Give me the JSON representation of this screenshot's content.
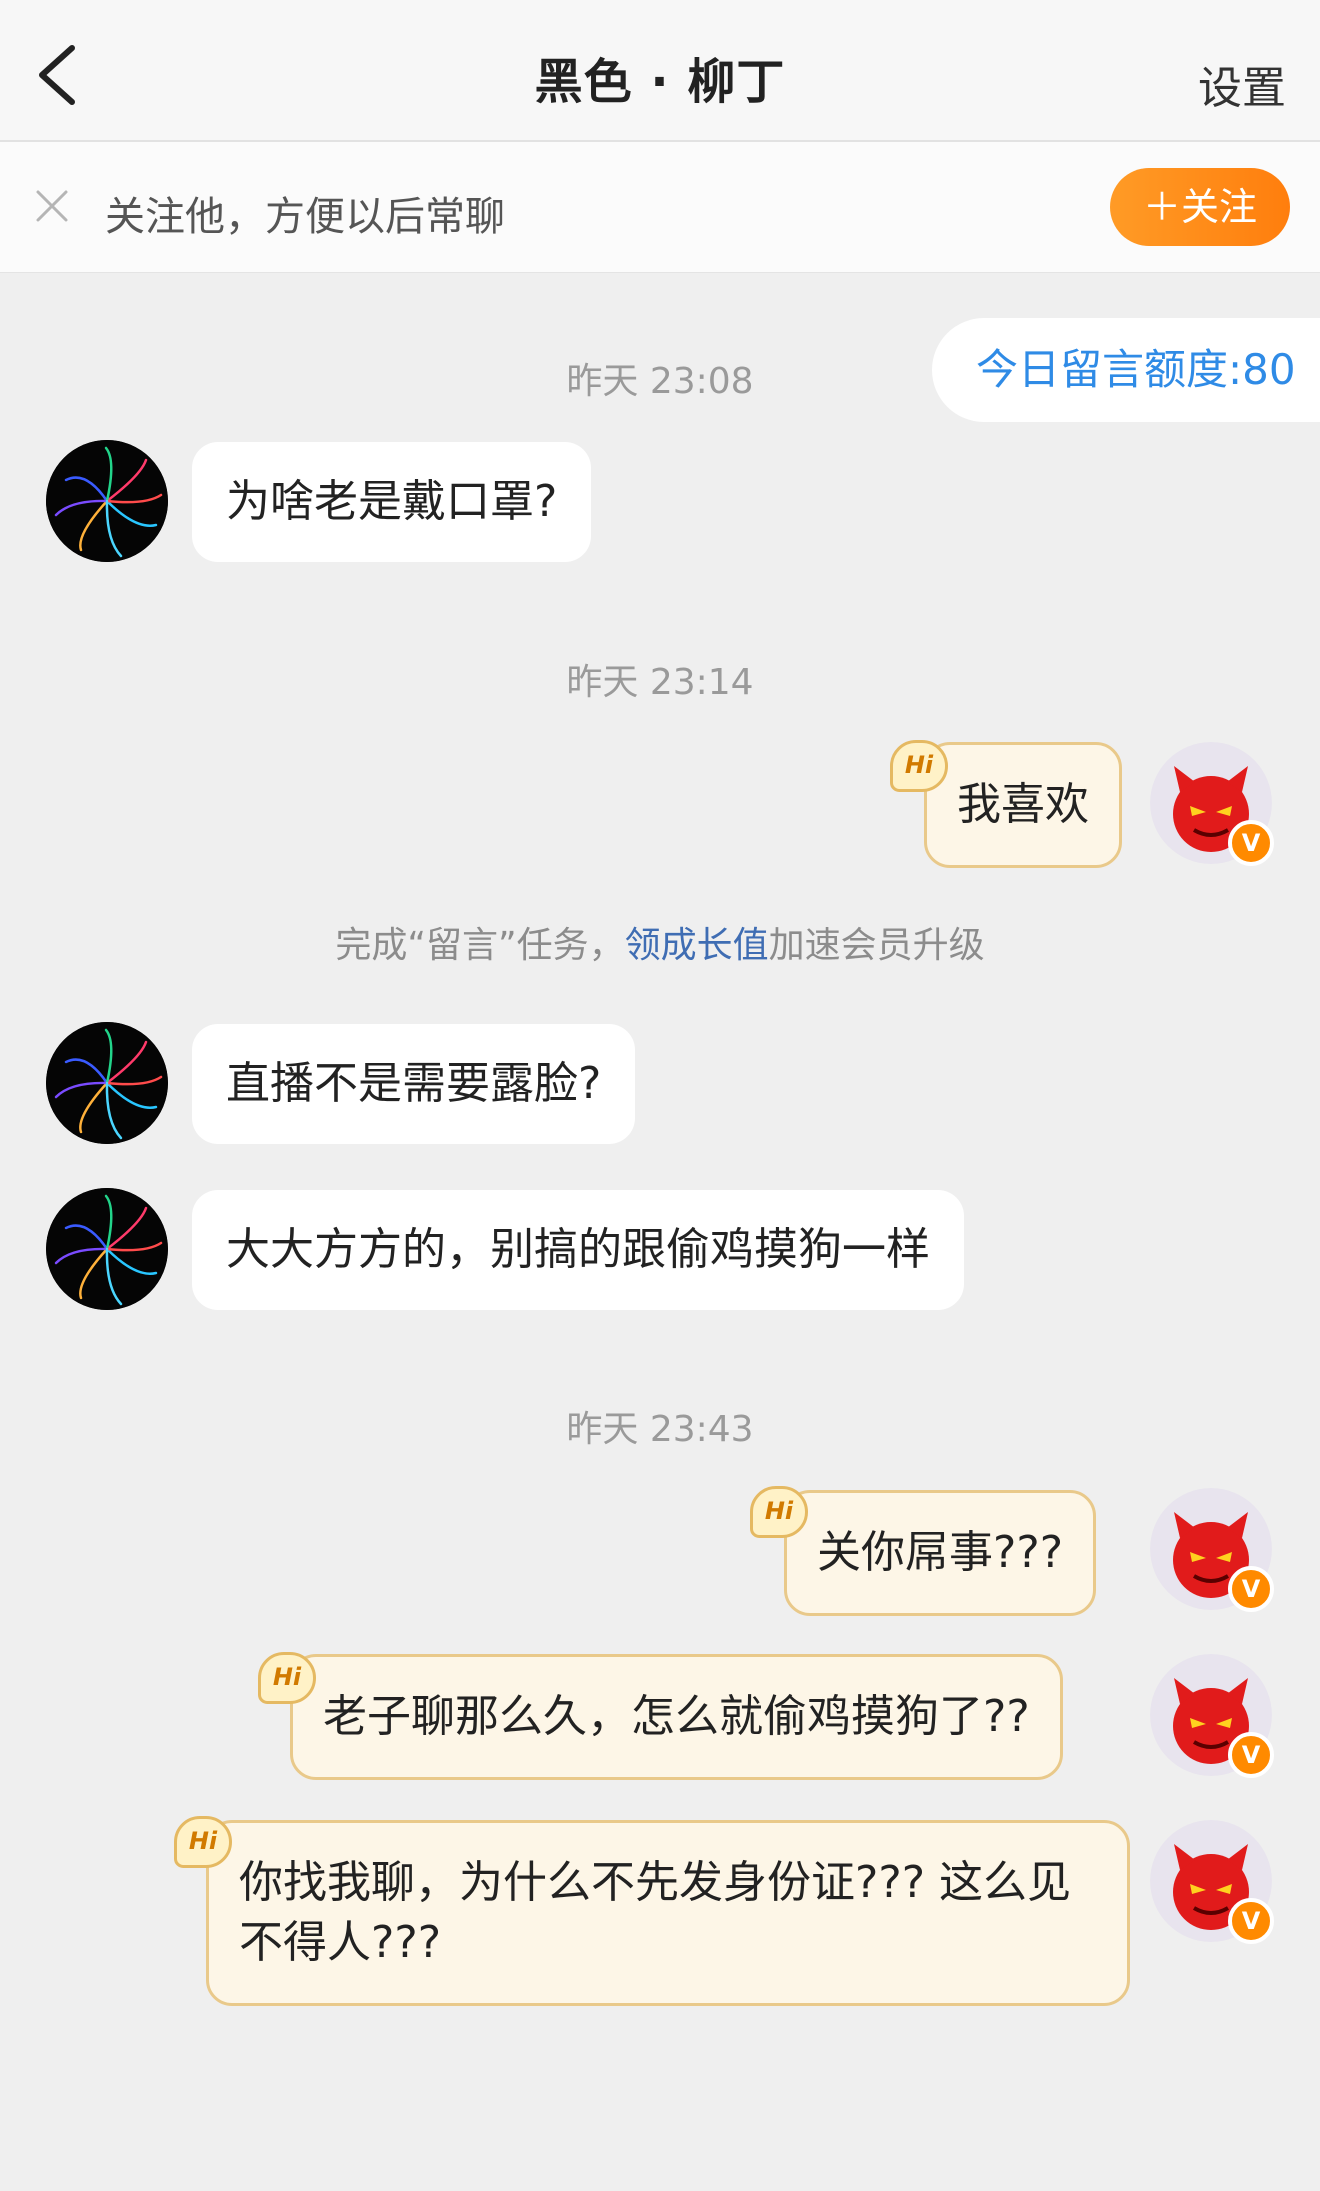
{
  "header": {
    "title": "黑色 · 柳丁",
    "settings_label": "设置"
  },
  "follow_bar": {
    "text": "关注他，方便以后常聊",
    "button_label": "＋关注"
  },
  "quota": {
    "label": "今日留言额度:80"
  },
  "timestamps": [
    "昨天 23:08",
    "昨天 23:14",
    "昨天 23:43"
  ],
  "task": {
    "prefix": "完成“留言”任务，",
    "link": "领成长值",
    "suffix": "加速会员升级"
  },
  "messages": [
    {
      "side": "left",
      "text": "为啥老是戴口罩?"
    },
    {
      "side": "right",
      "text": "我喜欢"
    },
    {
      "side": "left",
      "text": "直播不是需要露脸?"
    },
    {
      "side": "left",
      "text": "大大方方的，别搞的跟偷鸡摸狗一样"
    },
    {
      "side": "right",
      "text": "关你屌事???"
    },
    {
      "side": "right",
      "text": "老子聊那么久，怎么就偷鸡摸狗了??"
    },
    {
      "side": "right",
      "text": "你找我聊，为什么不先发身份证??? 这么见不得人???"
    }
  ],
  "badges": {
    "hi": "Hi",
    "verified": "V"
  },
  "colors": {
    "accent_orange": "#ff8a00",
    "link_blue": "#2f8be6",
    "bubble_right_bg": "#fdf6e7"
  },
  "icons": {
    "back": "chevron-left-icon",
    "close": "close-icon",
    "avatar_left": "dark-swirl",
    "avatar_right": "red-devil-mascot"
  }
}
